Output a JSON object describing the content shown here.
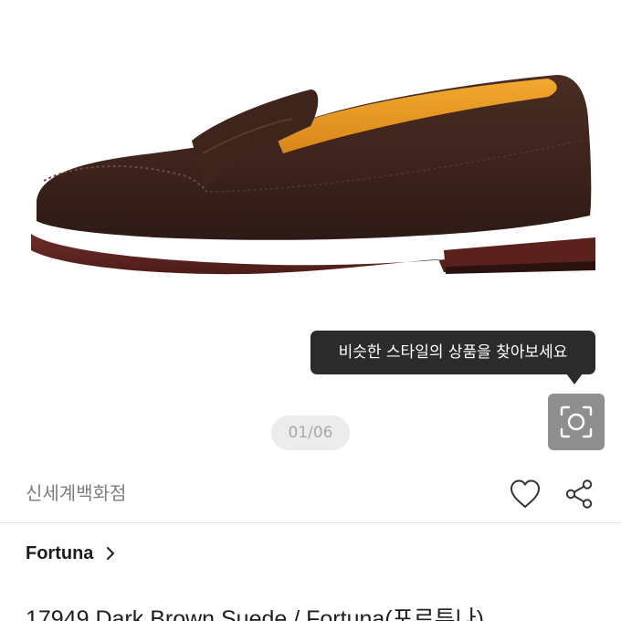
{
  "gallery": {
    "image_alt": "Dark brown suede penny loafer",
    "pager": {
      "current": "01",
      "total": "06",
      "label": "01/06"
    },
    "similar_style_tooltip": "비슷한 스타일의 상품을 찾아보세요",
    "lens_icon": "camera-lens-search-icon"
  },
  "store": {
    "name": "신세계백화점",
    "like_icon": "heart-outline-icon",
    "share_icon": "share-icon"
  },
  "brand": {
    "name": "Fortuna",
    "chevron_icon": "chevron-right-icon"
  },
  "product": {
    "title": "17949 Dark Brown Suede / Fortuna(포르투나)"
  },
  "colors": {
    "tooltip_bg": "#2b2b2b",
    "lens_button_bg": "#8f8f8f",
    "pager_bg": "#ececec",
    "divider": "#e6e6e6"
  }
}
